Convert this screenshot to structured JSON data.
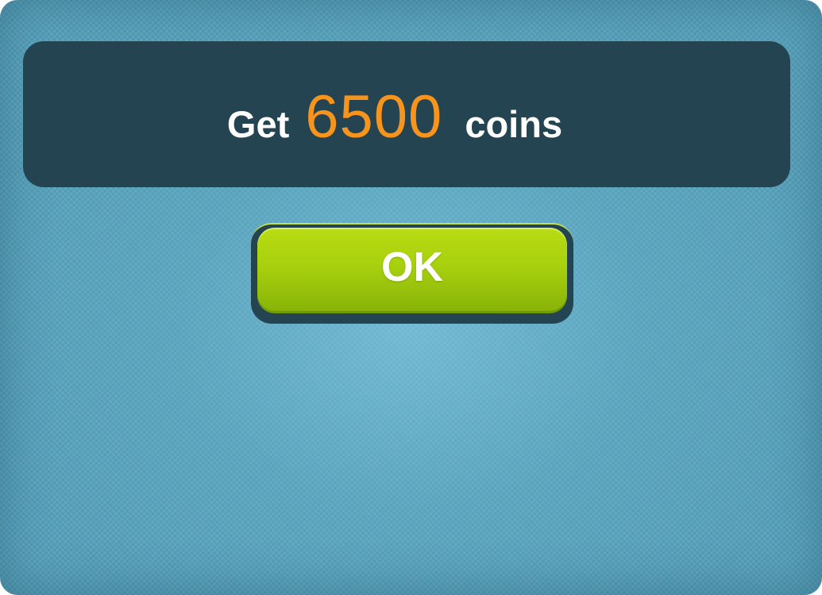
{
  "banner": {
    "prefix": "Get",
    "amount": "6500",
    "suffix": "coins"
  },
  "ok_button": {
    "label": "OK"
  },
  "colors": {
    "background": "#4f9ab5",
    "banner": "#244451",
    "amount": "#f7941d",
    "button": "#a8d00e"
  }
}
